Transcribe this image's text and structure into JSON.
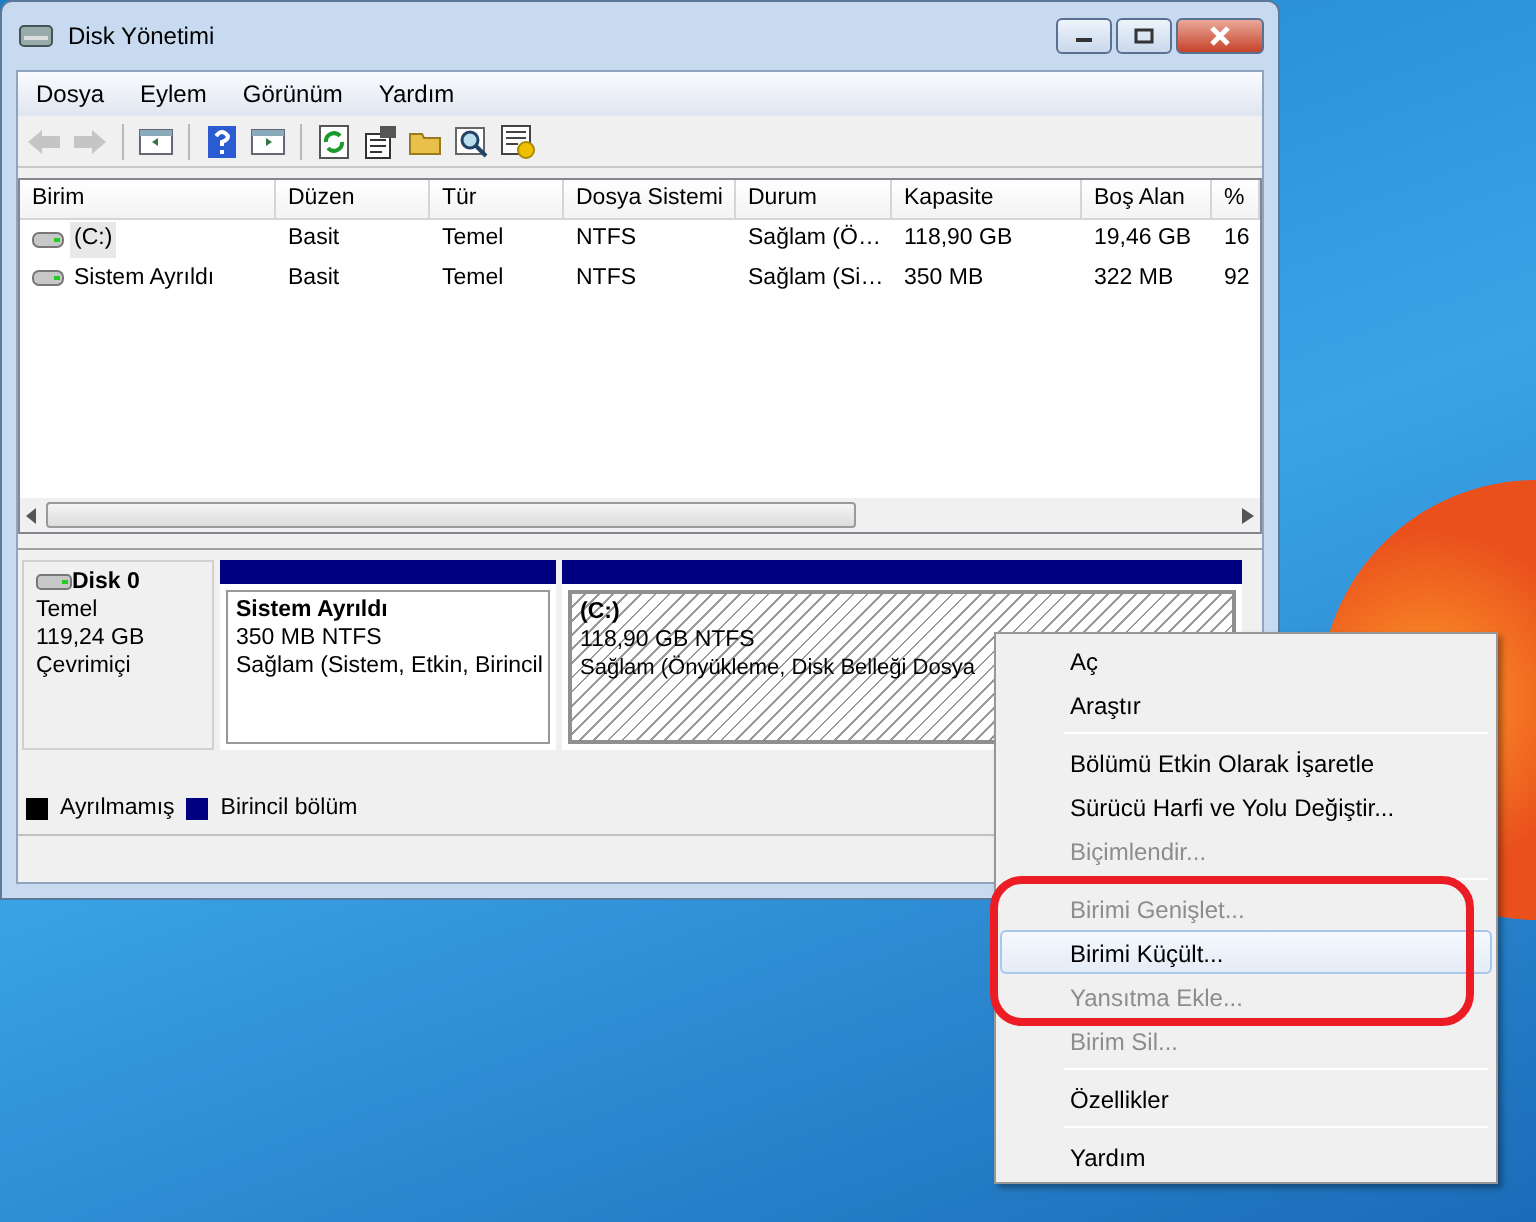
{
  "window": {
    "title": "Disk Yönetimi"
  },
  "menu_bar": [
    "Dosya",
    "Eylem",
    "Görünüm",
    "Yardım"
  ],
  "toolbar": [
    {
      "kind": "back",
      "disabled": true
    },
    {
      "kind": "forward",
      "disabled": true
    },
    {
      "kind": "sep"
    },
    {
      "kind": "panel",
      "disabled": false
    },
    {
      "kind": "sep"
    },
    {
      "kind": "help",
      "disabled": false
    },
    {
      "kind": "panel2",
      "disabled": false
    },
    {
      "kind": "sep"
    },
    {
      "kind": "refresh",
      "disabled": false
    },
    {
      "kind": "properties",
      "disabled": false
    },
    {
      "kind": "folder",
      "disabled": false
    },
    {
      "kind": "search",
      "disabled": false
    },
    {
      "kind": "settings",
      "disabled": false
    }
  ],
  "table": {
    "columns": [
      "Birim",
      "Düzen",
      "Tür",
      "Dosya Sistemi",
      "Durum",
      "Kapasite",
      "Boş Alan",
      "%"
    ],
    "rows": [
      {
        "selected": true,
        "cells": [
          "(C:)",
          "Basit",
          "Temel",
          "NTFS",
          "Sağlam (Ö…",
          "118,90 GB",
          "19,46 GB",
          "16"
        ]
      },
      {
        "selected": false,
        "cells": [
          "Sistem Ayrıldı",
          "Basit",
          "Temel",
          "NTFS",
          "Sağlam (Si…",
          "350 MB",
          "322 MB",
          "92"
        ]
      }
    ]
  },
  "disk": {
    "name": "Disk 0",
    "type": "Temel",
    "size": "119,24 GB",
    "status": "Çevrimiçi",
    "partitions": [
      {
        "name": "Sistem Ayrıldı",
        "size": "350 MB NTFS",
        "status": "Sağlam (Sistem, Etkin, Birincil",
        "selected": false
      },
      {
        "name": "(C:)",
        "size": "118,90 GB NTFS",
        "status": "Sağlam (Önyükleme, Disk Belleği Dosya",
        "selected": true
      }
    ]
  },
  "legend": [
    {
      "label": "Ayrılmamış",
      "color": "#000000"
    },
    {
      "label": "Birincil bölüm",
      "color": "#000080"
    }
  ],
  "context_menu": [
    {
      "kind": "item",
      "label": "Aç",
      "disabled": false,
      "selected": false
    },
    {
      "kind": "item",
      "label": "Araştır",
      "disabled": false,
      "selected": false
    },
    {
      "kind": "separator"
    },
    {
      "kind": "item",
      "label": "Bölümü Etkin Olarak İşaretle",
      "disabled": false,
      "selected": false
    },
    {
      "kind": "item",
      "label": "Sürücü Harfi ve Yolu Değiştir...",
      "disabled": false,
      "selected": false
    },
    {
      "kind": "item",
      "label": "Biçimlendir...",
      "disabled": true,
      "selected": false
    },
    {
      "kind": "separator"
    },
    {
      "kind": "item",
      "label": "Birimi Genişlet...",
      "disabled": true,
      "selected": false
    },
    {
      "kind": "item",
      "label": "Birimi Küçült...",
      "disabled": false,
      "selected": true
    },
    {
      "kind": "item",
      "label": "Yansıtma Ekle...",
      "disabled": true,
      "selected": false
    },
    {
      "kind": "item",
      "label": "Birim Sil...",
      "disabled": true,
      "selected": false
    },
    {
      "kind": "separator"
    },
    {
      "kind": "item",
      "label": "Özellikler",
      "disabled": false,
      "selected": false
    },
    {
      "kind": "separator"
    },
    {
      "kind": "item",
      "label": "Yardım",
      "disabled": false,
      "selected": false
    }
  ]
}
